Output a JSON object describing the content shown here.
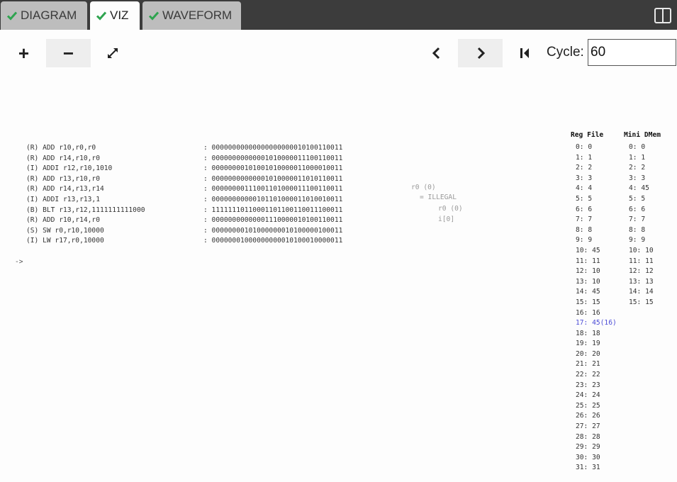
{
  "tabs": [
    {
      "label": "DIAGRAM",
      "active": false
    },
    {
      "label": "VIZ",
      "active": true
    },
    {
      "label": "WAVEFORM",
      "active": false
    }
  ],
  "colors": {
    "check": "#2ea44f",
    "highlight": "#4a4ad6",
    "tabbar": "#3c3c3c"
  },
  "toolbar": {
    "zoom_in": "+",
    "zoom_out": "−",
    "cycle_label": "Cycle:",
    "cycle_value": "60"
  },
  "program": [
    {
      "instr": "(R) ADD r10,r0,r0",
      "binary": ": 00000000000000000000010100110011"
    },
    {
      "instr": "(R) ADD r14,r10,r0",
      "binary": ": 00000000000001010000011100110011"
    },
    {
      "instr": "(I) ADDI r12,r10,1010",
      "binary": ": 00000000101001010000011000010011"
    },
    {
      "instr": "(R) ADD r13,r10,r0",
      "binary": ": 00000000000001010000011010110011"
    },
    {
      "instr": "(R) ADD r14,r13,r14",
      "binary": ": 00000000111001101000011100110011"
    },
    {
      "instr": "(I) ADDI r13,r13,1",
      "binary": ": 00000000000101101000011010010011"
    },
    {
      "instr": "(B) BLT r13,r12,1111111111000",
      "binary": ": 11111110110001101100110011100011"
    },
    {
      "instr": "(R) ADD r10,r14,r0",
      "binary": ": 00000000000001110000010100110011"
    },
    {
      "instr": "(S) SW r0,r10,10000",
      "binary": ": 00000000101000000010100000100011"
    },
    {
      "instr": "(I) LW r17,r0,10000",
      "binary": ": 00000001000000000010100010000011"
    }
  ],
  "pc_arrow": "->",
  "annotations": {
    "a1": "r0 (0)",
    "a2": "= ILLEGAL",
    "a3": "r0 (0)",
    "a4": "i[0]"
  },
  "regfile": {
    "title": "Reg File",
    "rows": [
      "0: 0",
      "1: 1",
      "2: 2",
      "3: 3",
      "4: 4",
      "5: 5",
      "6: 6",
      "7: 7",
      "8: 8",
      "9: 9",
      "10: 45",
      "11: 11",
      "12: 10",
      "13: 10",
      "14: 45",
      "15: 15",
      "16: 16",
      "17: 45(16)",
      "18: 18",
      "19: 19",
      "20: 20",
      "21: 21",
      "22: 22",
      "23: 23",
      "24: 24",
      "25: 25",
      "26: 26",
      "27: 27",
      "28: 28",
      "29: 29",
      "30: 30",
      "31: 31"
    ],
    "highlight_row": 17
  },
  "dmem": {
    "title": "Mini DMem",
    "rows": [
      "0: 0",
      "1: 1",
      "2: 2",
      "3: 3",
      "4: 45",
      "5: 5",
      "6: 6",
      "7: 7",
      "8: 8",
      "9: 9",
      "10: 10",
      "11: 11",
      "12: 12",
      "13: 13",
      "14: 14",
      "15: 15"
    ]
  }
}
